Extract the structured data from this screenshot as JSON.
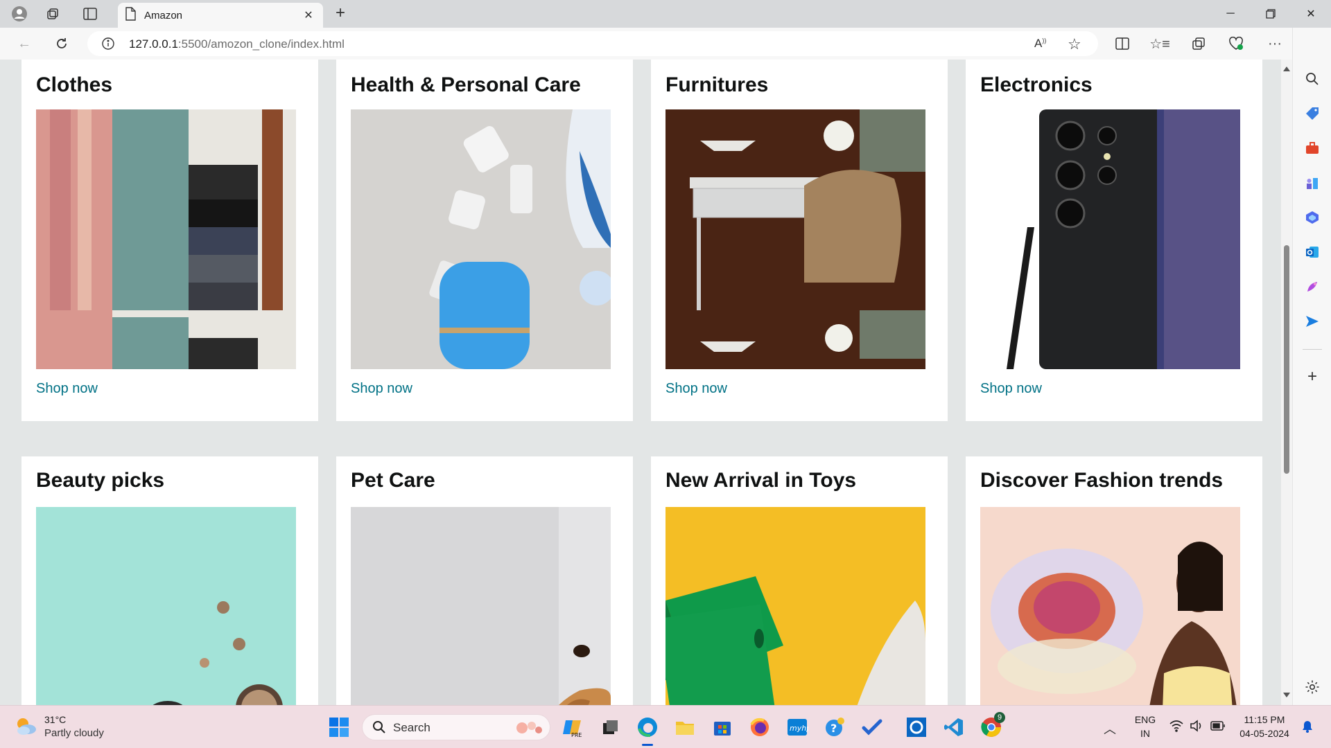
{
  "browser": {
    "tab_title": "Amazon",
    "url_host": "127.0.0.1",
    "url_path": ":5500/amozon_clone/index.html",
    "accent": "#0b57d0"
  },
  "cards": [
    {
      "title": "Clothes",
      "link": "Shop now",
      "image": "clothes-rack-image"
    },
    {
      "title": "Health & Personal Care",
      "link": "Shop now",
      "image": "personal-care-products-image"
    },
    {
      "title": "Furnitures",
      "link": "Shop now",
      "image": "desk-and-chair-image"
    },
    {
      "title": "Electronics",
      "link": "Shop now",
      "image": "smartphone-image"
    },
    {
      "title": "Beauty picks",
      "link": "",
      "image": "makeup-products-image"
    },
    {
      "title": "Pet Care",
      "link": "",
      "image": "dog-image"
    },
    {
      "title": "New Arrival in Toys",
      "link": "",
      "image": "toy-block-image"
    },
    {
      "title": "Discover Fashion trends",
      "link": "",
      "image": "fashion-model-image"
    }
  ],
  "colors": {
    "page_bg": "#e3e6e6",
    "card_bg": "#ffffff",
    "link": "#007185",
    "title": "#0f1111"
  },
  "taskbar": {
    "weather_temp": "31°C",
    "weather_desc": "Partly cloudy",
    "search_placeholder": "Search",
    "lang_line1": "ENG",
    "lang_line2": "IN",
    "time": "11:15 PM",
    "date": "04-05-2024",
    "chrome_badge": "9"
  }
}
